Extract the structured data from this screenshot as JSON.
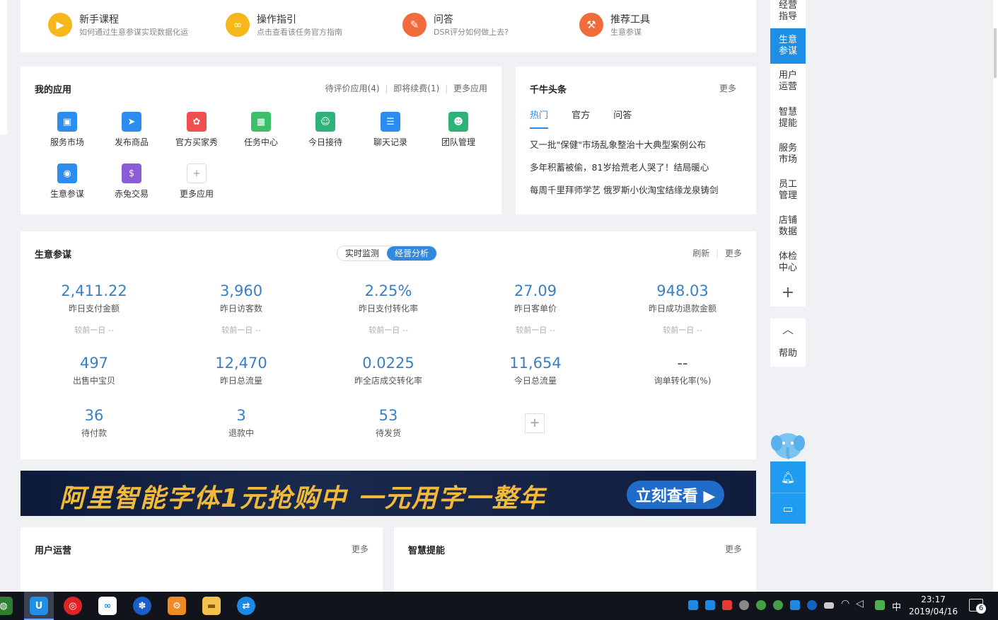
{
  "guide": {
    "items": [
      {
        "title": "新手课程",
        "sub": "如何通过生意参谋实现数据化运",
        "color": "#f5b71a",
        "icon": "play-icon"
      },
      {
        "title": "操作指引",
        "sub": "点击查看该任务官方指南",
        "color": "#f5b71a",
        "icon": "link-icon"
      },
      {
        "title": "问答",
        "sub": "DSR评分如何做上去?",
        "color": "#f26b3a",
        "icon": "pencil-icon"
      },
      {
        "title": "推荐工具",
        "sub": "生意参谋",
        "color": "#f26b3a",
        "icon": "tool-icon"
      }
    ]
  },
  "apps": {
    "title": "我的应用",
    "links": [
      "待评价应用(4)",
      "即将续费(1)",
      "更多应用"
    ],
    "items": [
      {
        "label": "服务市场",
        "color": "#2d8cf0"
      },
      {
        "label": "发布商品",
        "color": "#2d8cf0"
      },
      {
        "label": "官方买家秀",
        "color": "#f05050"
      },
      {
        "label": "任务中心",
        "color": "#3cbf6a"
      },
      {
        "label": "今日接待",
        "color": "#2db37a"
      },
      {
        "label": "聊天记录",
        "color": "#2d8cf0"
      },
      {
        "label": "团队管理",
        "color": "#2db37a"
      },
      {
        "label": "生意参谋",
        "color": "#2d8cf0"
      },
      {
        "label": "赤兔交易",
        "color": "#8a5cd6"
      },
      {
        "label": "更多应用",
        "color": ""
      }
    ]
  },
  "headlines": {
    "title": "千牛头条",
    "more": "更多",
    "tabs": [
      "热门",
      "官方",
      "问答"
    ],
    "news": [
      "又一批\"保健\"市场乱象整治十大典型案例公布",
      "多年积蓄被偷，81岁拾荒老人哭了！结局暖心",
      "每周千里拜师学艺 俄罗斯小伙淘宝结缘龙泉铸剑"
    ]
  },
  "business": {
    "title": "生意参谋",
    "seg": [
      "实时监测",
      "经营分析"
    ],
    "refresh": "刷新",
    "more": "更多",
    "cmp": "较前一日 --",
    "metrics": [
      {
        "value": "2,411.22",
        "label": "昨日支付金额"
      },
      {
        "value": "3,960",
        "label": "昨日访客数"
      },
      {
        "value": "2.25%",
        "label": "昨日支付转化率"
      },
      {
        "value": "27.09",
        "label": "昨日客单价"
      },
      {
        "value": "948.03",
        "label": "昨日成功退款金额"
      },
      {
        "value": "497",
        "label": "出售中宝贝"
      },
      {
        "value": "12,470",
        "label": "昨日总流量"
      },
      {
        "value": "0.0225",
        "label": "昨全店成交转化率"
      },
      {
        "value": "11,654",
        "label": "今日总流量"
      },
      {
        "value": "--",
        "label": "询单转化率(%)"
      },
      {
        "value": "36",
        "label": "待付款"
      },
      {
        "value": "3",
        "label": "退款中"
      },
      {
        "value": "53",
        "label": "待发货"
      }
    ],
    "add": "+"
  },
  "banner": {
    "text": "阿里智能字体1元抢购中 一元用字一整年",
    "button": "立刻查看 ▶"
  },
  "bottom": {
    "left_title": "用户运营",
    "right_title": "智慧提能",
    "more": "更多"
  },
  "rightnav": {
    "items": [
      "经营\n指导",
      "生意\n参谋",
      "用户\n运营",
      "智慧\n提能",
      "服务\n市场",
      "员工\n管理",
      "店铺\n数据",
      "体检\n中心"
    ],
    "active": 1,
    "add": "+",
    "help": "帮助"
  },
  "taskbar": {
    "time": "23:17",
    "date": "2019/04/16",
    "ime": "中",
    "notifications": "6"
  }
}
